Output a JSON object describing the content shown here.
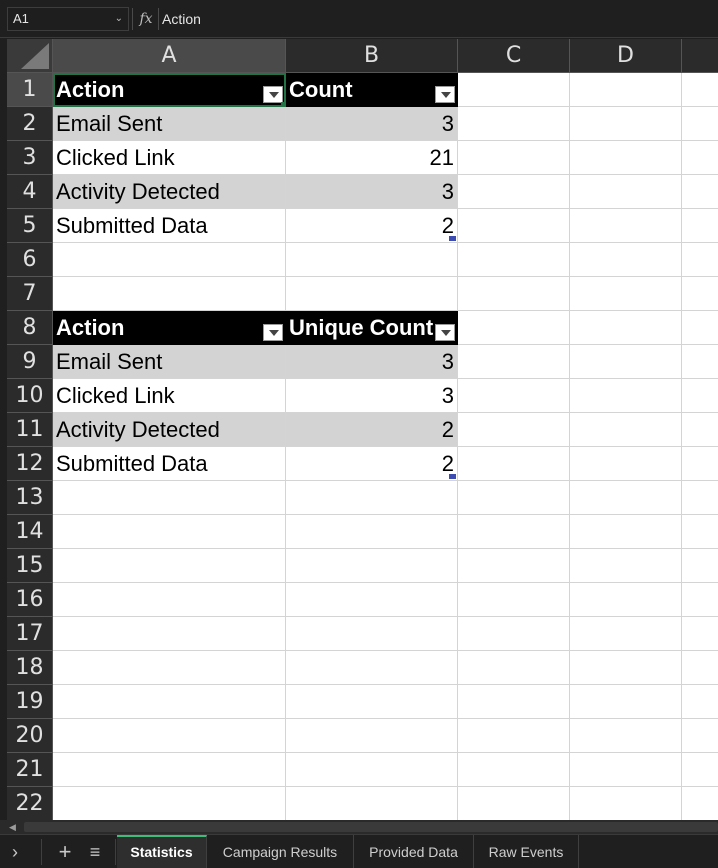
{
  "formula_bar": {
    "cell_ref": "A1",
    "fx_label": "fx",
    "formula": "Action"
  },
  "columns": [
    "A",
    "B",
    "C",
    "D"
  ],
  "rows": [
    "1",
    "2",
    "3",
    "4",
    "5",
    "6",
    "7",
    "8",
    "9",
    "10",
    "11",
    "12",
    "13",
    "14",
    "15",
    "16",
    "17",
    "18",
    "19",
    "20",
    "21",
    "22"
  ],
  "table1": {
    "header": [
      "Action",
      "Count"
    ],
    "rows": [
      [
        "Email Sent",
        "3"
      ],
      [
        "Clicked Link",
        "21"
      ],
      [
        "Activity Detected",
        "3"
      ],
      [
        "Submitted Data",
        "2"
      ]
    ]
  },
  "table2": {
    "header": [
      "Action",
      "Unique Count"
    ],
    "rows": [
      [
        "Email Sent",
        "3"
      ],
      [
        "Clicked Link",
        "3"
      ],
      [
        "Activity Detected",
        "2"
      ],
      [
        "Submitted Data",
        "2"
      ]
    ]
  },
  "sheet_tabs": [
    "Statistics",
    "Campaign Results",
    "Provided Data",
    "Raw Events"
  ],
  "active_sheet": "Statistics",
  "icons": {
    "nav": "chevron-right-icon",
    "add": "plus-icon",
    "list": "list-icon",
    "scroll_left": "arrow-left-icon"
  },
  "colors": {
    "header_fill": "#000000",
    "band_fill": "#d3d3d3",
    "active_tab_accent": "#3cbe7a",
    "selection_border": "#217346"
  }
}
